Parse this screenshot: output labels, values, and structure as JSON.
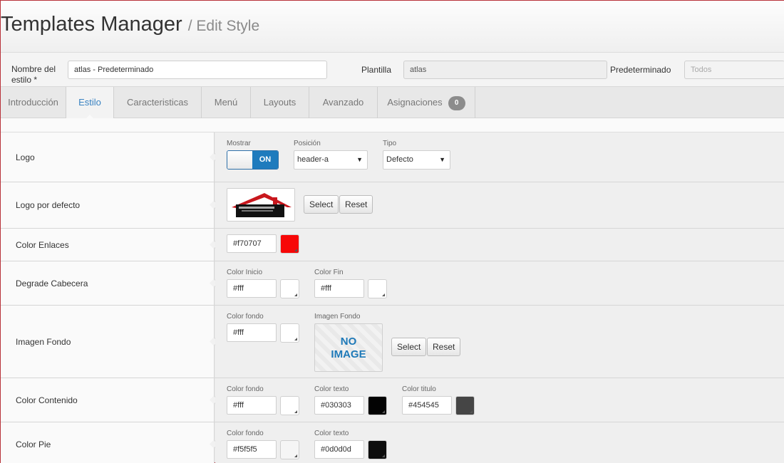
{
  "header": {
    "title": "Templates Manager",
    "subtitle": "/ Edit Style"
  },
  "stylebar": {
    "name_label": "Nombre del estilo *",
    "name_value": "atlas - Predeterminado",
    "template_label": "Plantilla",
    "template_value": "atlas",
    "default_label": "Predeterminado",
    "default_value": "Todos"
  },
  "tabs": [
    {
      "label": "Introducción"
    },
    {
      "label": "Estilo"
    },
    {
      "label": "Caracteristicas"
    },
    {
      "label": "Menú"
    },
    {
      "label": "Layouts"
    },
    {
      "label": "Avanzado"
    },
    {
      "label": "Asignaciones",
      "badge": "0"
    }
  ],
  "active_tab": "Estilo",
  "rows": {
    "logo": {
      "label": "Logo",
      "mostrar_label": "Mostrar",
      "toggle_on": "ON",
      "posicion_label": "Posición",
      "posicion_value": "header-a",
      "tipo_label": "Tipo",
      "tipo_value": "Defecto"
    },
    "logo_defecto": {
      "label": "Logo por defecto",
      "select": "Select",
      "reset": "Reset"
    },
    "color_enlaces": {
      "label": "Color Enlaces",
      "value": "#f70707",
      "swatch": "#f70707"
    },
    "degrade": {
      "label": "Degrade Cabecera",
      "inicio_label": "Color Inicio",
      "inicio_value": "#fff",
      "inicio_swatch": "#ffffff",
      "fin_label": "Color Fin",
      "fin_value": "#fff",
      "fin_swatch": "#ffffff"
    },
    "imagen_fondo": {
      "label": "Imagen Fondo",
      "color_label": "Color fondo",
      "color_value": "#fff",
      "color_swatch": "#ffffff",
      "imagen_label": "Imagen Fondo",
      "noimg_line1": "NO",
      "noimg_line2": "IMAGE",
      "select": "Select",
      "reset": "Reset"
    },
    "color_contenido": {
      "label": "Color Contenido",
      "fondo_label": "Color fondo",
      "fondo_value": "#fff",
      "fondo_swatch": "#ffffff",
      "texto_label": "Color texto",
      "texto_value": "#030303",
      "texto_swatch": "#030303",
      "titulo_label": "Color titulo",
      "titulo_value": "#454545",
      "titulo_swatch": "#454545"
    },
    "color_pie": {
      "label": "Color Pie",
      "fondo_label": "Color fondo",
      "fondo_value": "#f5f5f5",
      "fondo_swatch": "#f5f5f5",
      "texto_label": "Color texto",
      "texto_value": "#0d0d0d",
      "texto_swatch": "#0d0d0d"
    }
  },
  "colors": {
    "accent": "#1f7bbd",
    "active_tab_text": "#3a83c2",
    "noimage_text": "#1e79b8"
  }
}
